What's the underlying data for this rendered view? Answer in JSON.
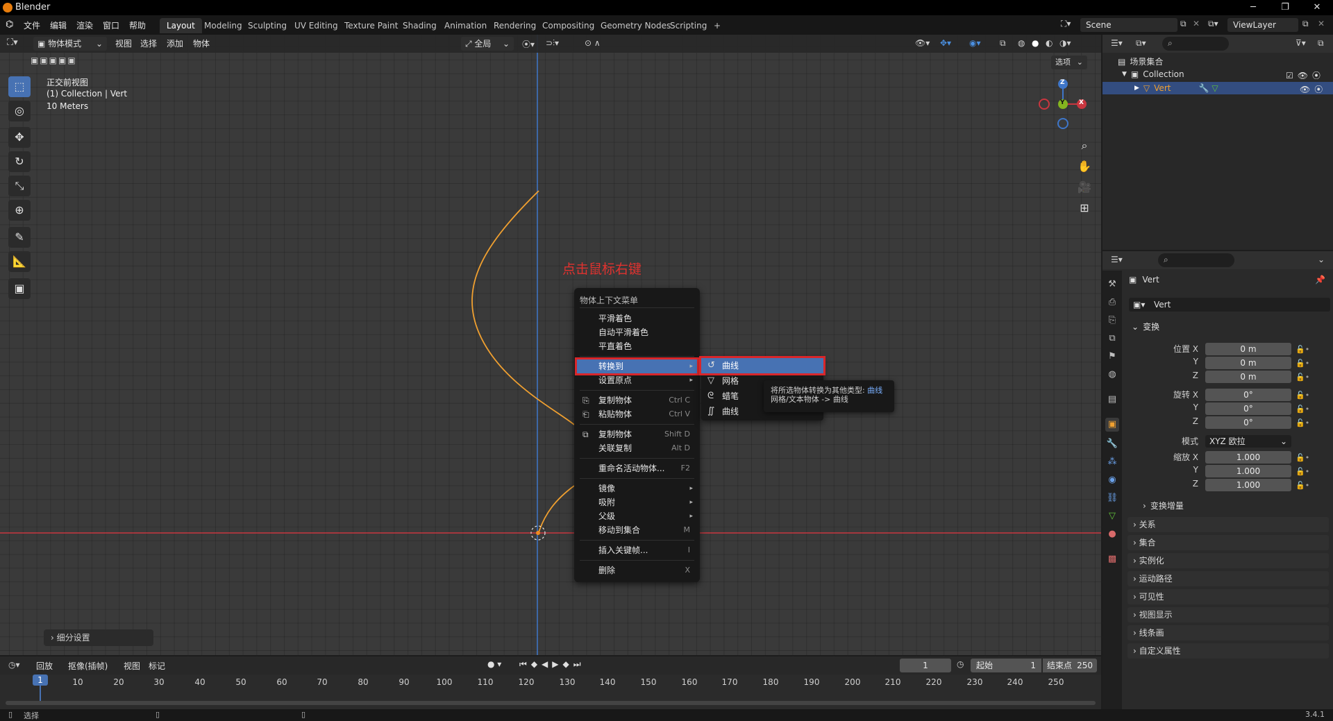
{
  "window": {
    "title": "Blender",
    "minimize": "─",
    "maximize": "❐",
    "close": "✕"
  },
  "menu": [
    "文件",
    "编辑",
    "渲染",
    "窗口",
    "帮助"
  ],
  "workspace_tabs": [
    "Layout",
    "Modeling",
    "Sculpting",
    "UV Editing",
    "Texture Paint",
    "Shading",
    "Animation",
    "Rendering",
    "Compositing",
    "Geometry Nodes",
    "Scripting",
    "+"
  ],
  "scene": {
    "name": "Scene",
    "view_layer": "ViewLayer"
  },
  "viewport_header": {
    "mode": "物体模式",
    "menus": [
      "视图",
      "选择",
      "添加",
      "物体"
    ],
    "transform_orientation": "全局",
    "options": "选项"
  },
  "viewport_info": {
    "view": "正交前视图",
    "collection": "(1) Collection | Vert",
    "scale": "10 Meters"
  },
  "annotation": {
    "text": "点击鼠标右键",
    "color": "#e0322f"
  },
  "gizmo": {
    "z": "Z",
    "y": "Y",
    "x": "X"
  },
  "context_menu": {
    "title": "物体上下文菜单",
    "items": [
      {
        "label": "平滑着色",
        "shortcut": ""
      },
      {
        "label": "自动平滑着色",
        "shortcut": ""
      },
      {
        "label": "平直着色",
        "shortcut": ""
      },
      {
        "label": "转换到",
        "shortcut": "▸",
        "highlighted": true
      },
      {
        "label": "设置原点",
        "shortcut": "▸"
      },
      {
        "label": "复制物体",
        "shortcut": "Ctrl C"
      },
      {
        "label": "粘贴物体",
        "shortcut": "Ctrl V"
      },
      {
        "label": "复制物体",
        "shortcut": "Shift D"
      },
      {
        "label": "关联复制",
        "shortcut": "Alt D"
      },
      {
        "label": "重命名活动物体...",
        "shortcut": "F2"
      },
      {
        "label": "镜像",
        "shortcut": "▸"
      },
      {
        "label": "吸附",
        "shortcut": "▸"
      },
      {
        "label": "父级",
        "shortcut": "▸"
      },
      {
        "label": "移动到集合",
        "shortcut": "M"
      },
      {
        "label": "插入关键帧...",
        "shortcut": "I"
      },
      {
        "label": "删除",
        "shortcut": "X"
      }
    ]
  },
  "submenu": {
    "items": [
      {
        "label": "曲线",
        "icon": "curve-icon"
      },
      {
        "label": "网格",
        "icon": "mesh-icon"
      },
      {
        "label": "蜡笔",
        "icon": "grease-pencil-icon"
      },
      {
        "label": "曲线",
        "icon": "curves-icon"
      }
    ]
  },
  "tooltip": {
    "line1": "将所选物体转换为其他类型: ",
    "line1_hl": "曲线",
    "line2": "网格/文本物体 -> 曲线"
  },
  "subdivide_panel": "细分设置",
  "outliner": {
    "root": "场景集合",
    "collection": "Collection",
    "object": "Vert"
  },
  "properties": {
    "object_name": "Vert",
    "object_field": "Vert",
    "transform_header": "变换",
    "location": {
      "label_x": "位置 X",
      "x": "0 m",
      "y": "0 m",
      "z": "0 m"
    },
    "rotation": {
      "label_x": "旋转 X",
      "x": "0°",
      "y": "0°",
      "z": "0°"
    },
    "mode_label": "模式",
    "mode_value": "XYZ 欧拉",
    "scale": {
      "label_x": "缩放 X",
      "x": "1.000",
      "y": "1.000",
      "z": "1.000"
    },
    "axis_y": "Y",
    "axis_z": "Z",
    "delta": "变换增量",
    "panels": [
      "关系",
      "集合",
      "实例化",
      "运动路径",
      "可见性",
      "视图显示",
      "线条画",
      "自定义属性"
    ]
  },
  "timeline": {
    "menus": [
      "回放",
      "抠像(插帧)",
      "视图",
      "标记"
    ],
    "current_frame": "1",
    "start_label": "起始",
    "start": "1",
    "end_label": "结束点",
    "end": "250",
    "ticks": [
      "10",
      "20",
      "30",
      "40",
      "50",
      "60",
      "70",
      "80",
      "90",
      "100",
      "110",
      "120",
      "130",
      "140",
      "150",
      "160",
      "170",
      "180",
      "190",
      "200",
      "210",
      "220",
      "230",
      "240",
      "250"
    ],
    "playhead": "1"
  },
  "status": {
    "left": "选择",
    "version": "3.4.1"
  }
}
